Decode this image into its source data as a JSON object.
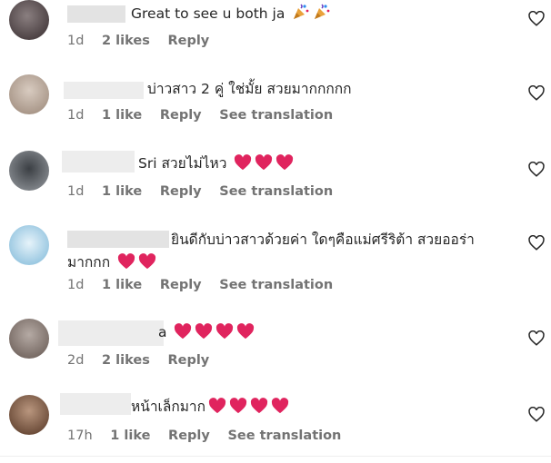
{
  "comments": [
    {
      "text": "Great to see u both ja",
      "emoji": "party-popper",
      "emoji_count": 2,
      "time": "1d",
      "likes": "2 likes",
      "reply": "Reply",
      "translate": ""
    },
    {
      "text": "บ่าวสาว 2 คู่ ใช่มั้ย สวยมากกกกก",
      "time": "1d",
      "likes": "1 like",
      "reply": "Reply",
      "translate": "See translation"
    },
    {
      "text": "Sri สวยไม่ไหว",
      "emoji": "red-heart",
      "emoji_count": 3,
      "time": "1d",
      "likes": "1 like",
      "reply": "Reply",
      "translate": "See translation"
    },
    {
      "text": "ยินดีกับบ่าวสาวด้วยค่า ใดๆคือแม่ศรีริต้า สวยออร่ามากกก",
      "emoji": "red-heart",
      "emoji_count": 2,
      "time": "1d",
      "likes": "1 like",
      "reply": "Reply",
      "translate": "See translation"
    },
    {
      "text": "a",
      "emoji": "red-heart",
      "emoji_count": 4,
      "time": "2d",
      "likes": "2 likes",
      "reply": "Reply",
      "translate": ""
    },
    {
      "text": "หน้าเล็กมาก",
      "emoji": "red-heart",
      "emoji_count": 4,
      "time": "17h",
      "likes": "1 like",
      "reply": "Reply",
      "translate": "See translation"
    }
  ],
  "like_icon": "heart-outline-icon",
  "colors": {
    "text": "#262626",
    "meta": "#737373",
    "heart": "#e0245e",
    "redaction": "#e3e3e3"
  }
}
